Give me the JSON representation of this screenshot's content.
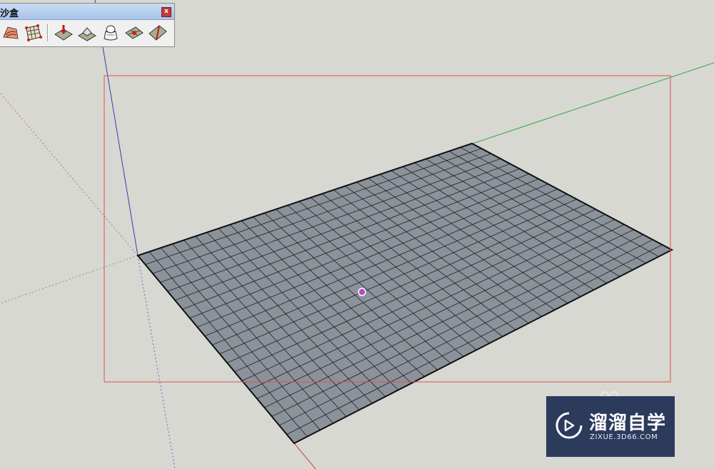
{
  "toolbar": {
    "title": "沙盒",
    "close_label": "x",
    "tools": [
      {
        "name": "from-contours-tool",
        "icon": "from-contours-icon"
      },
      {
        "name": "from-scratch-tool",
        "icon": "from-scratch-icon"
      },
      {
        "name": "smoove-tool",
        "icon": "smoove-icon"
      },
      {
        "name": "stamp-tool",
        "icon": "stamp-icon"
      },
      {
        "name": "drape-tool",
        "icon": "drape-icon"
      },
      {
        "name": "add-detail-tool",
        "icon": "add-detail-icon"
      },
      {
        "name": "flip-edge-tool",
        "icon": "flip-edge-icon"
      }
    ]
  },
  "watermark": {
    "brand": "溜溜自学",
    "domain": "ZIXUE.3D66.COM"
  },
  "colors": {
    "background": "#d7d8d1",
    "grid_fill": "#8b9299",
    "grid_line": "#1e2125",
    "red_axis": "#d04848",
    "green_axis": "#36a336",
    "blue_axis": "#3a3ab8",
    "selection_box": "#e05050",
    "center_point": "#b04cc8",
    "logo_bg": "#2c3a5c"
  }
}
